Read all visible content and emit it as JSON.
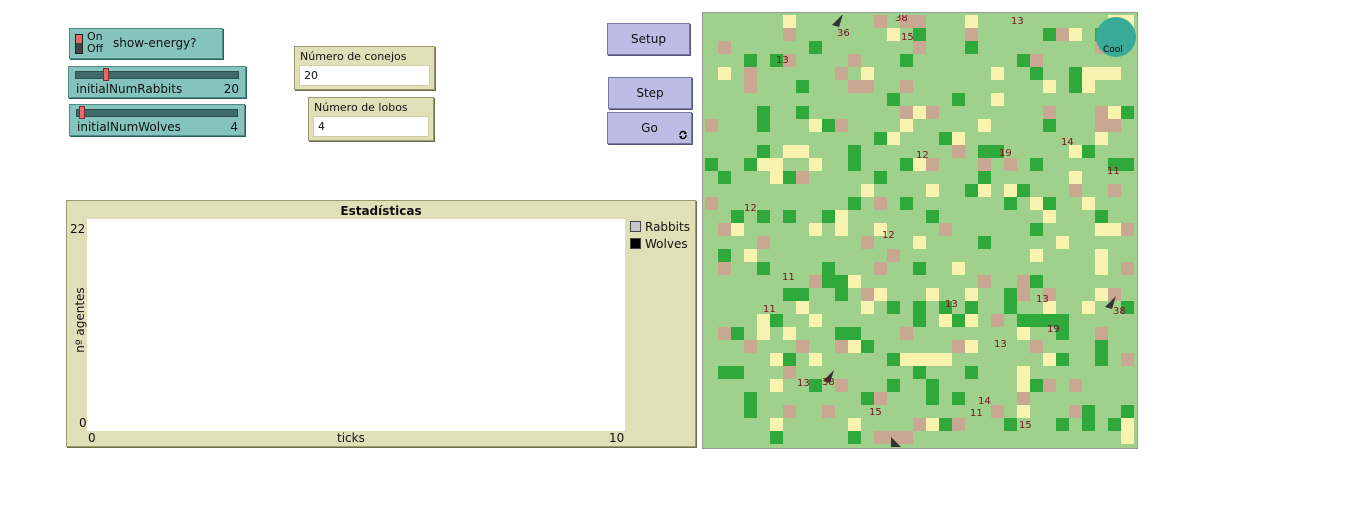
{
  "switch": {
    "on_label": "On",
    "off_label": "Off",
    "label": "show-energy?"
  },
  "sliders": [
    {
      "label": "initialNumRabbits",
      "value": "20",
      "level": 0.15
    },
    {
      "label": "initialNumWolves",
      "value": "4",
      "level": 0.02
    }
  ],
  "monitors": {
    "rabbits": {
      "title": "Número de conejos",
      "value": "20"
    },
    "wolves": {
      "title": "Número de lobos",
      "value": "4"
    }
  },
  "buttons": {
    "setup": "Setup",
    "step": "Step",
    "go": "Go",
    "go_forever_icon": "cycle-icon"
  },
  "plot": {
    "title": "Estadísticas",
    "ylabel": "nº agentes",
    "xlabel": "ticks",
    "ymin": "0",
    "ymax": "22",
    "xmin": "0",
    "xmax": "10",
    "legend": [
      {
        "name": "Rabbits",
        "color": "#c8c8c8"
      },
      {
        "name": "Wolves",
        "color": "#000000"
      }
    ]
  },
  "chart_data": {
    "type": "line",
    "title": "Estadísticas",
    "xlabel": "ticks",
    "ylabel": "nº agentes",
    "xlim": [
      0,
      10
    ],
    "ylim": [
      0,
      22
    ],
    "series": [
      {
        "name": "Rabbits",
        "color": "#c8c8c8",
        "values": []
      },
      {
        "name": "Wolves",
        "color": "#000000",
        "values": []
      }
    ]
  },
  "world": {
    "colors": {
      "grass_light": "#9fd08c",
      "grass_dark": "#2fa83c",
      "sand": "#f8f4b0",
      "dirt": "#c8a890",
      "sun": "#3aaa98"
    },
    "sun_label": "Cool",
    "energy_labels": [
      "38",
      "15",
      "13",
      "13",
      "12",
      "19",
      "14",
      "11",
      "12",
      "12",
      "11",
      "11",
      "13",
      "13",
      "19",
      "13",
      "38",
      "13",
      "14",
      "15",
      "11",
      "15",
      "36",
      "38"
    ]
  }
}
